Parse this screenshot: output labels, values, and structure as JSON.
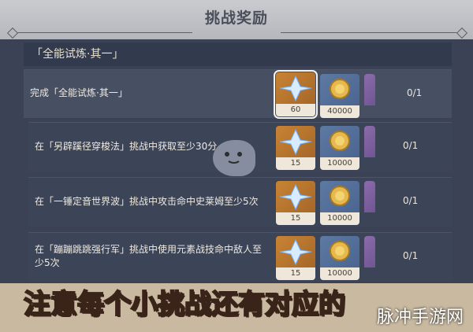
{
  "title": "挑战奖励",
  "section_title": "「全能试炼·其一」",
  "rows": [
    {
      "text": "完成「全能试炼·其一」",
      "rewards": [
        {
          "type": "primogem",
          "qty": "60",
          "selected": true
        },
        {
          "type": "mora",
          "qty": "40000",
          "selected": false
        }
      ],
      "count": "0/1"
    },
    {
      "text": "在「另辟蹊径穿梭法」挑战中获取至少30分",
      "rewards": [
        {
          "type": "primogem",
          "qty": "15",
          "selected": false
        },
        {
          "type": "mora",
          "qty": "10000",
          "selected": false
        }
      ],
      "count": "0/1"
    },
    {
      "text": "在「一锤定音世界波」挑战中攻击命中史莱姆至少5次",
      "rewards": [
        {
          "type": "primogem",
          "qty": "15",
          "selected": false
        },
        {
          "type": "mora",
          "qty": "10000",
          "selected": false
        }
      ],
      "count": "0/1"
    },
    {
      "text": "在「蹦蹦跳跳强行军」挑战中使用元素战技命中敌人至少5次",
      "text_line1": "在「蹦蹦跳跳强行军」挑战中使用元素战技命中敌人至",
      "text_line2": "少5次",
      "rewards": [
        {
          "type": "primogem",
          "qty": "15",
          "selected": false
        },
        {
          "type": "mora",
          "qty": "10000",
          "selected": false
        }
      ],
      "count": "0/1"
    }
  ],
  "subtitle": "注意每个小挑战还有对应的",
  "watermark": "脉冲手游网",
  "colors": {
    "primogem": "#c88434",
    "mora": "#5d7aa3",
    "subtitle": "#f0df47"
  },
  "icons": [
    "primogem-icon",
    "mora-icon",
    "ghost-mascot-icon"
  ]
}
